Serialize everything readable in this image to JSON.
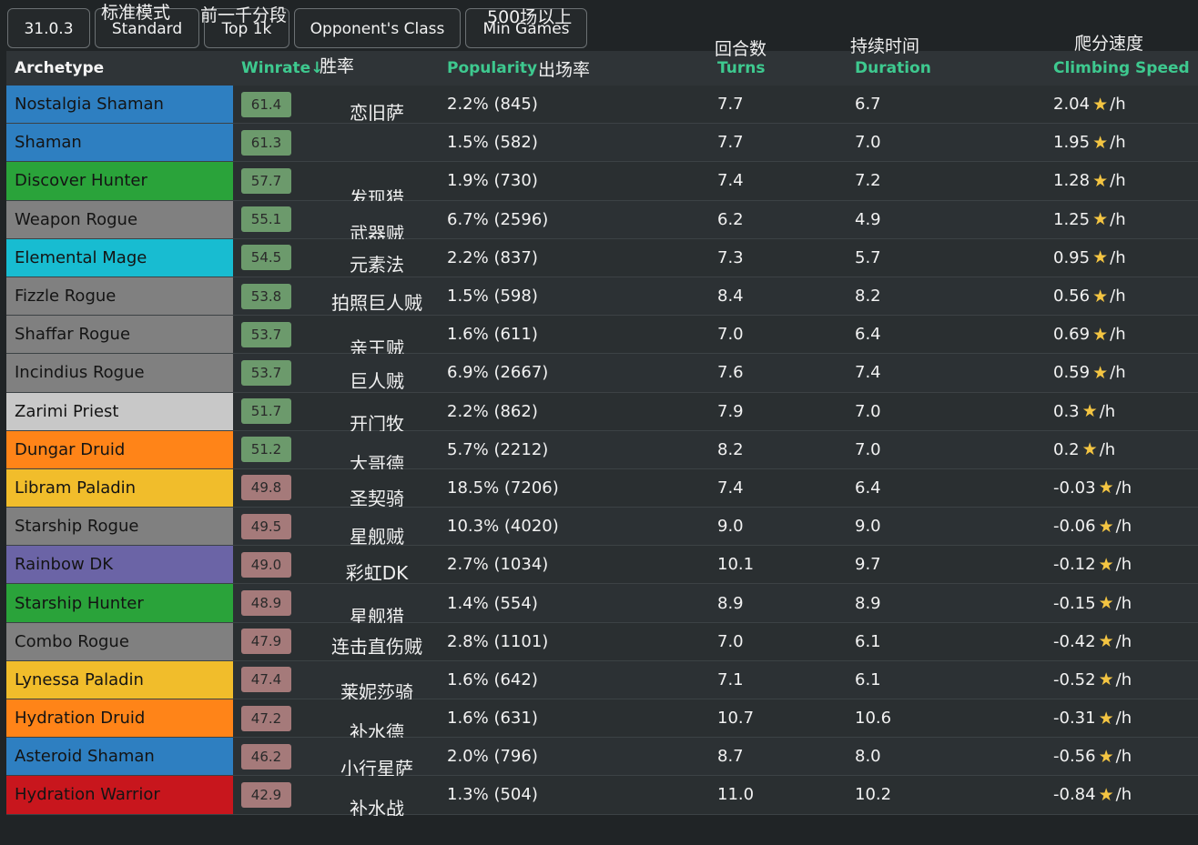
{
  "filters": {
    "version": "31.0.3",
    "mode": "Standard",
    "mode_cn": "标准模式",
    "rank": "Top 1k",
    "rank_cn": "前一千分段",
    "opponent": "Opponent's Class",
    "min_games": "Min Games",
    "min_games_cn": "500场以上"
  },
  "header": {
    "archetype": "Archetype",
    "winrate": "Winrate↓",
    "winrate_cn": "胜率",
    "popularity": "Popularity",
    "popularity_cn": "出场率",
    "turns": "Turns",
    "turns_cn": "回合数",
    "duration": "Duration",
    "duration_cn": "持续时间",
    "climbing": "Climbing Speed",
    "climbing_cn": "爬分速度"
  },
  "colors": {
    "accent_green": "#3ec98f",
    "win_positive": "#6c9a6c",
    "win_negative": "#a57a7a",
    "star": "#f4c542"
  },
  "rows": [
    {
      "name": "Nostalgia Shaman",
      "cn": "恋旧萨",
      "winrate": "61.4",
      "popularity": "2.2% (845)",
      "turns": "7.7",
      "duration": "6.7",
      "climb": "2.04",
      "unit": "/h",
      "color": "#2e7fc1",
      "positive": true
    },
    {
      "name": "Shaman",
      "cn": "",
      "winrate": "61.3",
      "popularity": "1.5% (582)",
      "turns": "7.7",
      "duration": "7.0",
      "climb": "1.95",
      "unit": "/h",
      "color": "#2e7fc1",
      "positive": true
    },
    {
      "name": "Discover Hunter",
      "cn": "发现猎",
      "winrate": "57.7",
      "popularity": "1.9% (730)",
      "turns": "7.4",
      "duration": "7.2",
      "climb": "1.28",
      "unit": "/h",
      "color": "#2aa33a",
      "positive": true
    },
    {
      "name": "Weapon Rogue",
      "cn": "武器贼",
      "winrate": "55.1",
      "popularity": "6.7% (2596)",
      "turns": "6.2",
      "duration": "4.9",
      "climb": "1.25",
      "unit": "/h",
      "color": "#808080",
      "positive": true
    },
    {
      "name": "Elemental Mage",
      "cn": "元素法",
      "winrate": "54.5",
      "popularity": "2.2% (837)",
      "turns": "7.3",
      "duration": "5.7",
      "climb": "0.95",
      "unit": "/h",
      "color": "#18bcd1",
      "positive": true
    },
    {
      "name": "Fizzle Rogue",
      "cn": "拍照巨人贼",
      "winrate": "53.8",
      "popularity": "1.5% (598)",
      "turns": "8.4",
      "duration": "8.2",
      "climb": "0.56",
      "unit": "/h",
      "color": "#808080",
      "positive": true
    },
    {
      "name": "Shaffar Rogue",
      "cn": "亲王贼",
      "winrate": "53.7",
      "popularity": "1.6% (611)",
      "turns": "7.0",
      "duration": "6.4",
      "climb": "0.69",
      "unit": "/h",
      "color": "#808080",
      "positive": true
    },
    {
      "name": "Incindius Rogue",
      "cn": "巨人贼",
      "winrate": "53.7",
      "popularity": "6.9% (2667)",
      "turns": "7.6",
      "duration": "7.4",
      "climb": "0.59",
      "unit": "/h",
      "color": "#808080",
      "positive": true
    },
    {
      "name": "Zarimi Priest",
      "cn": "开门牧",
      "winrate": "51.7",
      "popularity": "2.2% (862)",
      "turns": "7.9",
      "duration": "7.0",
      "climb": "0.3",
      "unit": "/h",
      "color": "#c8c8c8",
      "positive": true
    },
    {
      "name": "Dungar Druid",
      "cn": "大哥德",
      "winrate": "51.2",
      "popularity": "5.7% (2212)",
      "turns": "8.2",
      "duration": "7.0",
      "climb": "0.2",
      "unit": "/h",
      "color": "#ff8418",
      "positive": true
    },
    {
      "name": "Libram Paladin",
      "cn": "圣契骑",
      "winrate": "49.8",
      "popularity": "18.5% (7206)",
      "turns": "7.4",
      "duration": "6.4",
      "climb": "-0.03",
      "unit": "/h",
      "color": "#f1bd2b",
      "positive": false
    },
    {
      "name": "Starship Rogue",
      "cn": "星舰贼",
      "winrate": "49.5",
      "popularity": "10.3% (4020)",
      "turns": "9.0",
      "duration": "9.0",
      "climb": "-0.06",
      "unit": "/h",
      "color": "#808080",
      "positive": false
    },
    {
      "name": "Rainbow DK",
      "cn": "彩虹DK",
      "winrate": "49.0",
      "popularity": "2.7% (1034)",
      "turns": "10.1",
      "duration": "9.7",
      "climb": "-0.12",
      "unit": "/h",
      "color": "#6b64a6",
      "positive": false
    },
    {
      "name": "Starship Hunter",
      "cn": "星舰猎",
      "winrate": "48.9",
      "popularity": "1.4% (554)",
      "turns": "8.9",
      "duration": "8.9",
      "climb": "-0.15",
      "unit": "/h",
      "color": "#2aa33a",
      "positive": false
    },
    {
      "name": "Combo Rogue",
      "cn": "连击直伤贼",
      "winrate": "47.9",
      "popularity": "2.8% (1101)",
      "turns": "7.0",
      "duration": "6.1",
      "climb": "-0.42",
      "unit": "/h",
      "color": "#808080",
      "positive": false
    },
    {
      "name": "Lynessa Paladin",
      "cn": "莱妮莎骑",
      "winrate": "47.4",
      "popularity": "1.6% (642)",
      "turns": "7.1",
      "duration": "6.1",
      "climb": "-0.52",
      "unit": "/h",
      "color": "#f1bd2b",
      "positive": false
    },
    {
      "name": "Hydration Druid",
      "cn": "补水德",
      "winrate": "47.2",
      "popularity": "1.6% (631)",
      "turns": "10.7",
      "duration": "10.6",
      "climb": "-0.31",
      "unit": "/h",
      "color": "#ff8418",
      "positive": false
    },
    {
      "name": "Asteroid Shaman",
      "cn": "小行星萨",
      "winrate": "46.2",
      "popularity": "2.0% (796)",
      "turns": "8.7",
      "duration": "8.0",
      "climb": "-0.56",
      "unit": "/h",
      "color": "#2e7fc1",
      "positive": false
    },
    {
      "name": "Hydration Warrior",
      "cn": "补水战",
      "winrate": "42.9",
      "popularity": "1.3% (504)",
      "turns": "11.0",
      "duration": "10.2",
      "climb": "-0.84",
      "unit": "/h",
      "color": "#c8161d",
      "positive": false
    }
  ]
}
